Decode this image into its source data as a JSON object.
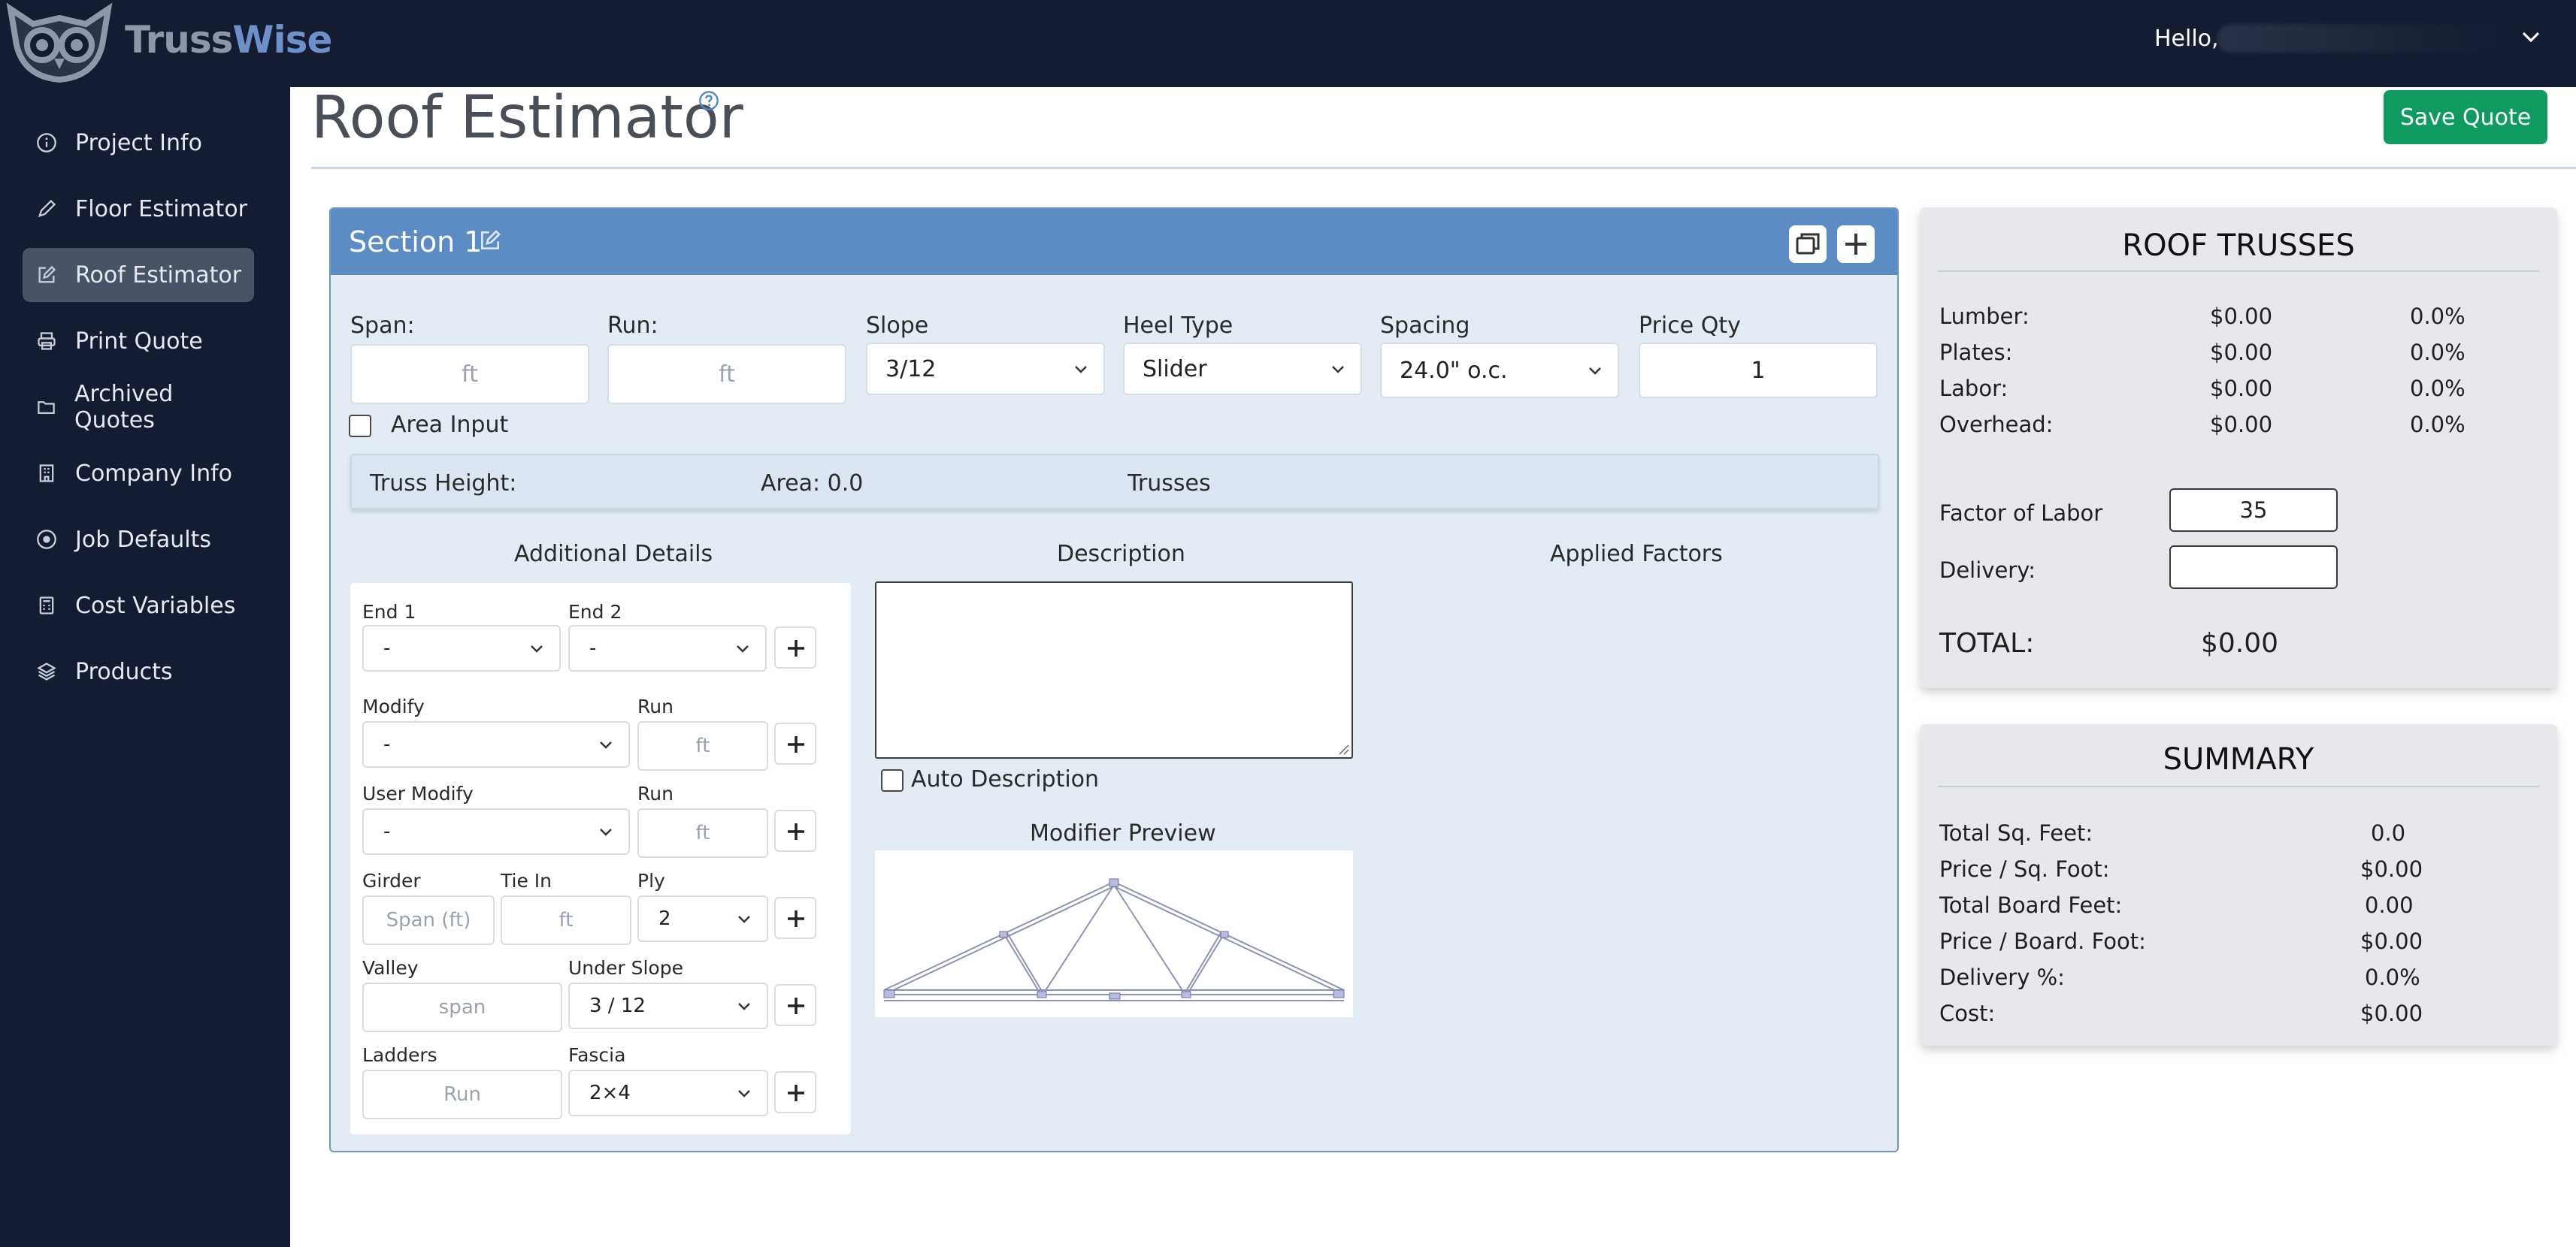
{
  "brand": {
    "part1": "Truss",
    "part2": "Wise"
  },
  "header": {
    "greeting": "Hello,"
  },
  "sidebar": {
    "items": [
      {
        "label": "Project Info",
        "icon": "info-icon"
      },
      {
        "label": "Floor Estimator",
        "icon": "pencil-icon"
      },
      {
        "label": "Roof Estimator",
        "icon": "edit-icon",
        "active": true
      },
      {
        "label": "Print Quote",
        "icon": "printer-icon"
      },
      {
        "label": "Archived Quotes",
        "icon": "folder-icon"
      },
      {
        "label": "Company Info",
        "icon": "building-icon"
      },
      {
        "label": "Job Defaults",
        "icon": "target-icon"
      },
      {
        "label": "Cost Variables",
        "icon": "calculator-icon"
      },
      {
        "label": "Products",
        "icon": "layers-icon"
      }
    ]
  },
  "page": {
    "title": "Roof Estimator",
    "save_label": "Save Quote"
  },
  "section": {
    "title": "Section 1",
    "span_label": "Span:",
    "span_placeholder": "ft",
    "run_label": "Run:",
    "run_placeholder": "ft",
    "slope_label": "Slope",
    "slope_value": "3/12",
    "heel_label": "Heel Type",
    "heel_value": "Slider",
    "spacing_label": "Spacing",
    "spacing_value": "24.0\" o.c.",
    "price_qty_label": "Price Qty",
    "price_qty_value": "1",
    "area_input_label": "Area Input",
    "truss_height_label": "Truss Height:",
    "area_label": "Area: 0.0",
    "trusses_label": "Trusses",
    "additional_details_label": "Additional Details",
    "description_label": "Description",
    "applied_factors_label": "Applied Factors",
    "auto_description_label": "Auto Description",
    "modifier_preview_label": "Modifier Preview",
    "details": {
      "end1_label": "End 1",
      "end1_value": "-",
      "end2_label": "End 2",
      "end2_value": "-",
      "modify_label": "Modify",
      "modify_value": "-",
      "modify_run_label": "Run",
      "modify_run_placeholder": "ft",
      "user_modify_label": "User Modify",
      "user_modify_value": "-",
      "user_run_label": "Run",
      "user_run_placeholder": "ft",
      "girder_label": "Girder",
      "girder_placeholder": "Span (ft)",
      "tiein_label": "Tie In",
      "tiein_placeholder": "ft",
      "ply_label": "Ply",
      "ply_value": "2",
      "valley_label": "Valley",
      "valley_placeholder": "span",
      "under_slope_label": "Under Slope",
      "under_slope_value": "3 / 12",
      "ladders_label": "Ladders",
      "ladders_placeholder": "Run",
      "fascia_label": "Fascia",
      "fascia_value": "2×4"
    }
  },
  "roof_trusses": {
    "title": "ROOF TRUSSES",
    "rows": [
      {
        "label": "Lumber:",
        "value": "$0.00",
        "pct": "0.0%"
      },
      {
        "label": "Plates:",
        "value": "$0.00",
        "pct": "0.0%"
      },
      {
        "label": "Labor:",
        "value": "$0.00",
        "pct": "0.0%"
      },
      {
        "label": "Overhead:",
        "value": "$0.00",
        "pct": "0.0%"
      }
    ],
    "factor_label": "Factor of Labor",
    "factor_value": "35",
    "delivery_label": "Delivery:",
    "delivery_value": "",
    "total_label": "TOTAL:",
    "total_value": "$0.00"
  },
  "summary": {
    "title": "SUMMARY",
    "rows": [
      {
        "label": "Total Sq. Feet:",
        "value": "0.0"
      },
      {
        "label": "Price / Sq. Foot:",
        "value": "$0.00"
      },
      {
        "label": "Total Board Feet:",
        "value": "0.00"
      },
      {
        "label": "Price / Board. Foot:",
        "value": "$0.00"
      },
      {
        "label": "Delivery %:",
        "value": "0.0%"
      },
      {
        "label": "Cost:",
        "value": "$0.00"
      }
    ]
  },
  "colors": {
    "nav_bg": "#131c30",
    "accent": "#5b8cc3",
    "save": "#0f9a5f"
  }
}
